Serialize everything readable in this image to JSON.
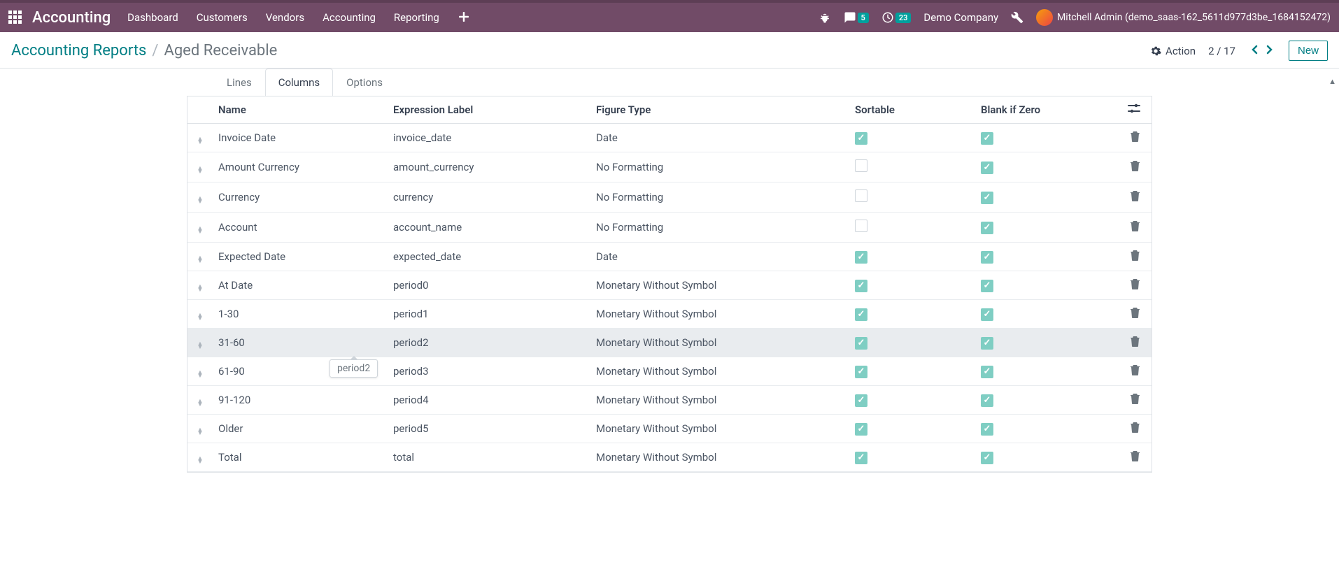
{
  "navbar": {
    "brand": "Accounting",
    "menu": [
      "Dashboard",
      "Customers",
      "Vendors",
      "Accounting",
      "Reporting"
    ],
    "messages_count": "5",
    "activities_count": "23",
    "company": "Demo Company",
    "user": "Mitchell Admin (demo_saas-162_5611d977d3be_1684152472)"
  },
  "breadcrumb": {
    "parent": "Accounting Reports",
    "current": "Aged Receivable"
  },
  "actions": {
    "action_label": "Action",
    "pager": "2 / 17",
    "new_label": "New"
  },
  "tabs": {
    "lines": "Lines",
    "columns": "Columns",
    "options": "Options"
  },
  "table": {
    "headers": {
      "name": "Name",
      "expression": "Expression Label",
      "figure": "Figure Type",
      "sortable": "Sortable",
      "blank": "Blank if Zero"
    },
    "rows": [
      {
        "name": "Invoice Date",
        "expr": "invoice_date",
        "figure": "Date",
        "sortable": true,
        "blank": true
      },
      {
        "name": "Amount Currency",
        "expr": "amount_currency",
        "figure": "No Formatting",
        "sortable": false,
        "blank": true
      },
      {
        "name": "Currency",
        "expr": "currency",
        "figure": "No Formatting",
        "sortable": false,
        "blank": true
      },
      {
        "name": "Account",
        "expr": "account_name",
        "figure": "No Formatting",
        "sortable": false,
        "blank": true
      },
      {
        "name": "Expected Date",
        "expr": "expected_date",
        "figure": "Date",
        "sortable": true,
        "blank": true
      },
      {
        "name": "At Date",
        "expr": "period0",
        "figure": "Monetary Without Symbol",
        "sortable": true,
        "blank": true
      },
      {
        "name": "1-30",
        "expr": "period1",
        "figure": "Monetary Without Symbol",
        "sortable": true,
        "blank": true
      },
      {
        "name": "31-60",
        "expr": "period2",
        "figure": "Monetary Without Symbol",
        "sortable": true,
        "blank": true,
        "hovered": true
      },
      {
        "name": "61-90",
        "expr": "period3",
        "figure": "Monetary Without Symbol",
        "sortable": true,
        "blank": true
      },
      {
        "name": "91-120",
        "expr": "period4",
        "figure": "Monetary Without Symbol",
        "sortable": true,
        "blank": true
      },
      {
        "name": "Older",
        "expr": "period5",
        "figure": "Monetary Without Symbol",
        "sortable": true,
        "blank": true
      },
      {
        "name": "Total",
        "expr": "total",
        "figure": "Monetary Without Symbol",
        "sortable": true,
        "blank": true
      }
    ]
  },
  "tooltip": {
    "text": "period2"
  }
}
